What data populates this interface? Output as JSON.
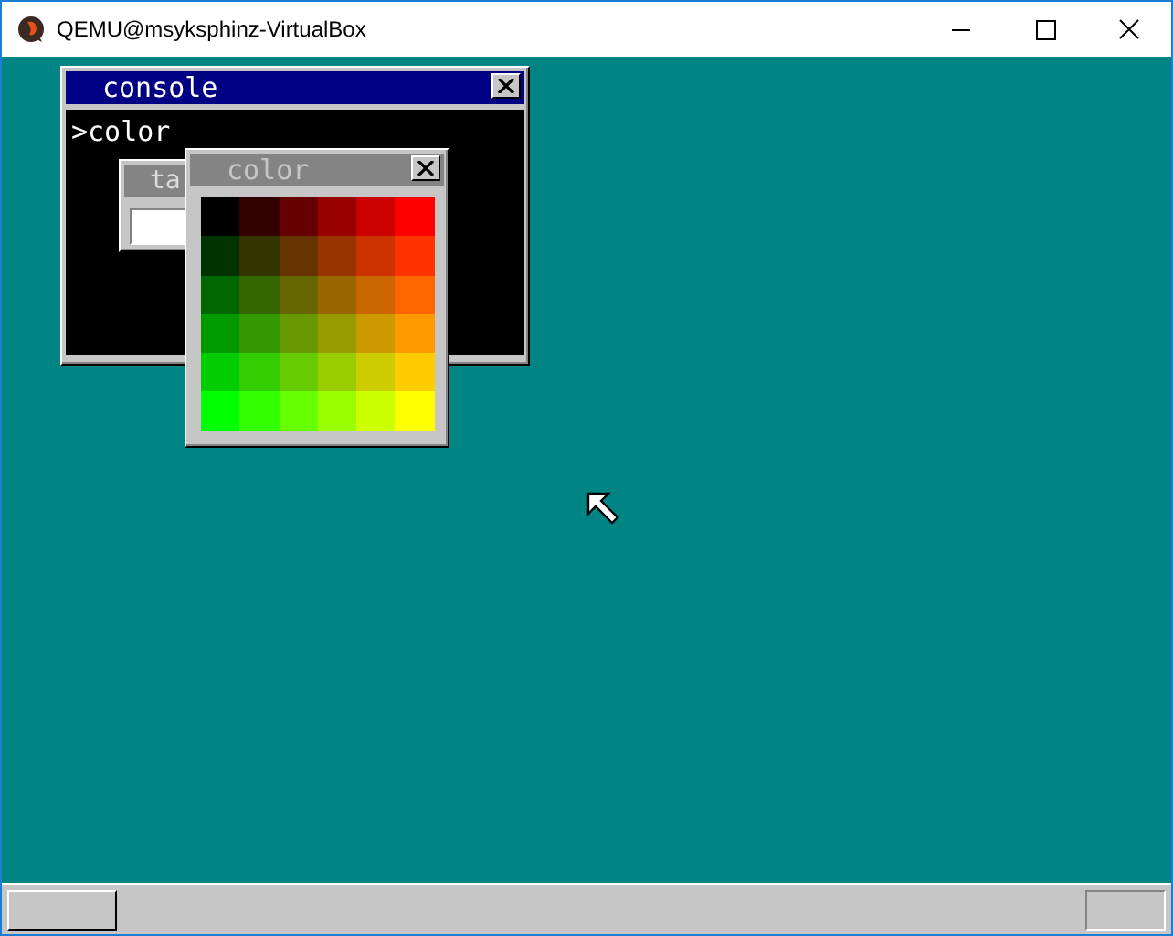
{
  "window": {
    "title": "QEMU@msyksphinz-VirtualBox"
  },
  "console": {
    "title": "console",
    "lines": [
      ">color"
    ]
  },
  "task_window": {
    "title": "ta"
  },
  "color_window": {
    "title": "color",
    "rows": [
      [
        {
          "color": "#000000"
        },
        {
          "color": "#330000"
        },
        {
          "color": "#660000"
        },
        {
          "color": "#990000"
        },
        {
          "color": "#cc0000"
        },
        {
          "color": "#ff0000"
        }
      ],
      [
        {
          "color": "#003300"
        },
        {
          "color": "#333300"
        },
        {
          "color": "#663300"
        },
        {
          "color": "#993300"
        },
        {
          "color": "#cc3300"
        },
        {
          "color": "#ff3300"
        }
      ],
      [
        {
          "color": "#006600"
        },
        {
          "color": "#336600"
        },
        {
          "color": "#666600"
        },
        {
          "color": "#996600"
        },
        {
          "color": "#cc6600"
        },
        {
          "color": "#ff6600"
        }
      ],
      [
        {
          "color": "#009900"
        },
        {
          "color": "#339900"
        },
        {
          "color": "#669900"
        },
        {
          "color": "#999900"
        },
        {
          "color": "#cc9900"
        },
        {
          "color": "#ff9900"
        }
      ],
      [
        {
          "color": "#00cc00"
        },
        {
          "color": "#33cc00"
        },
        {
          "color": "#66cc00"
        },
        {
          "color": "#99cc00"
        },
        {
          "color": "#cccc00"
        },
        {
          "color": "#ffcc00"
        }
      ],
      [
        {
          "color": "#00ff00"
        },
        {
          "color": "#33ff00"
        },
        {
          "color": "#66ff00"
        },
        {
          "color": "#99ff00"
        },
        {
          "color": "#ccff00"
        },
        {
          "color": "#ffff00"
        }
      ]
    ]
  }
}
